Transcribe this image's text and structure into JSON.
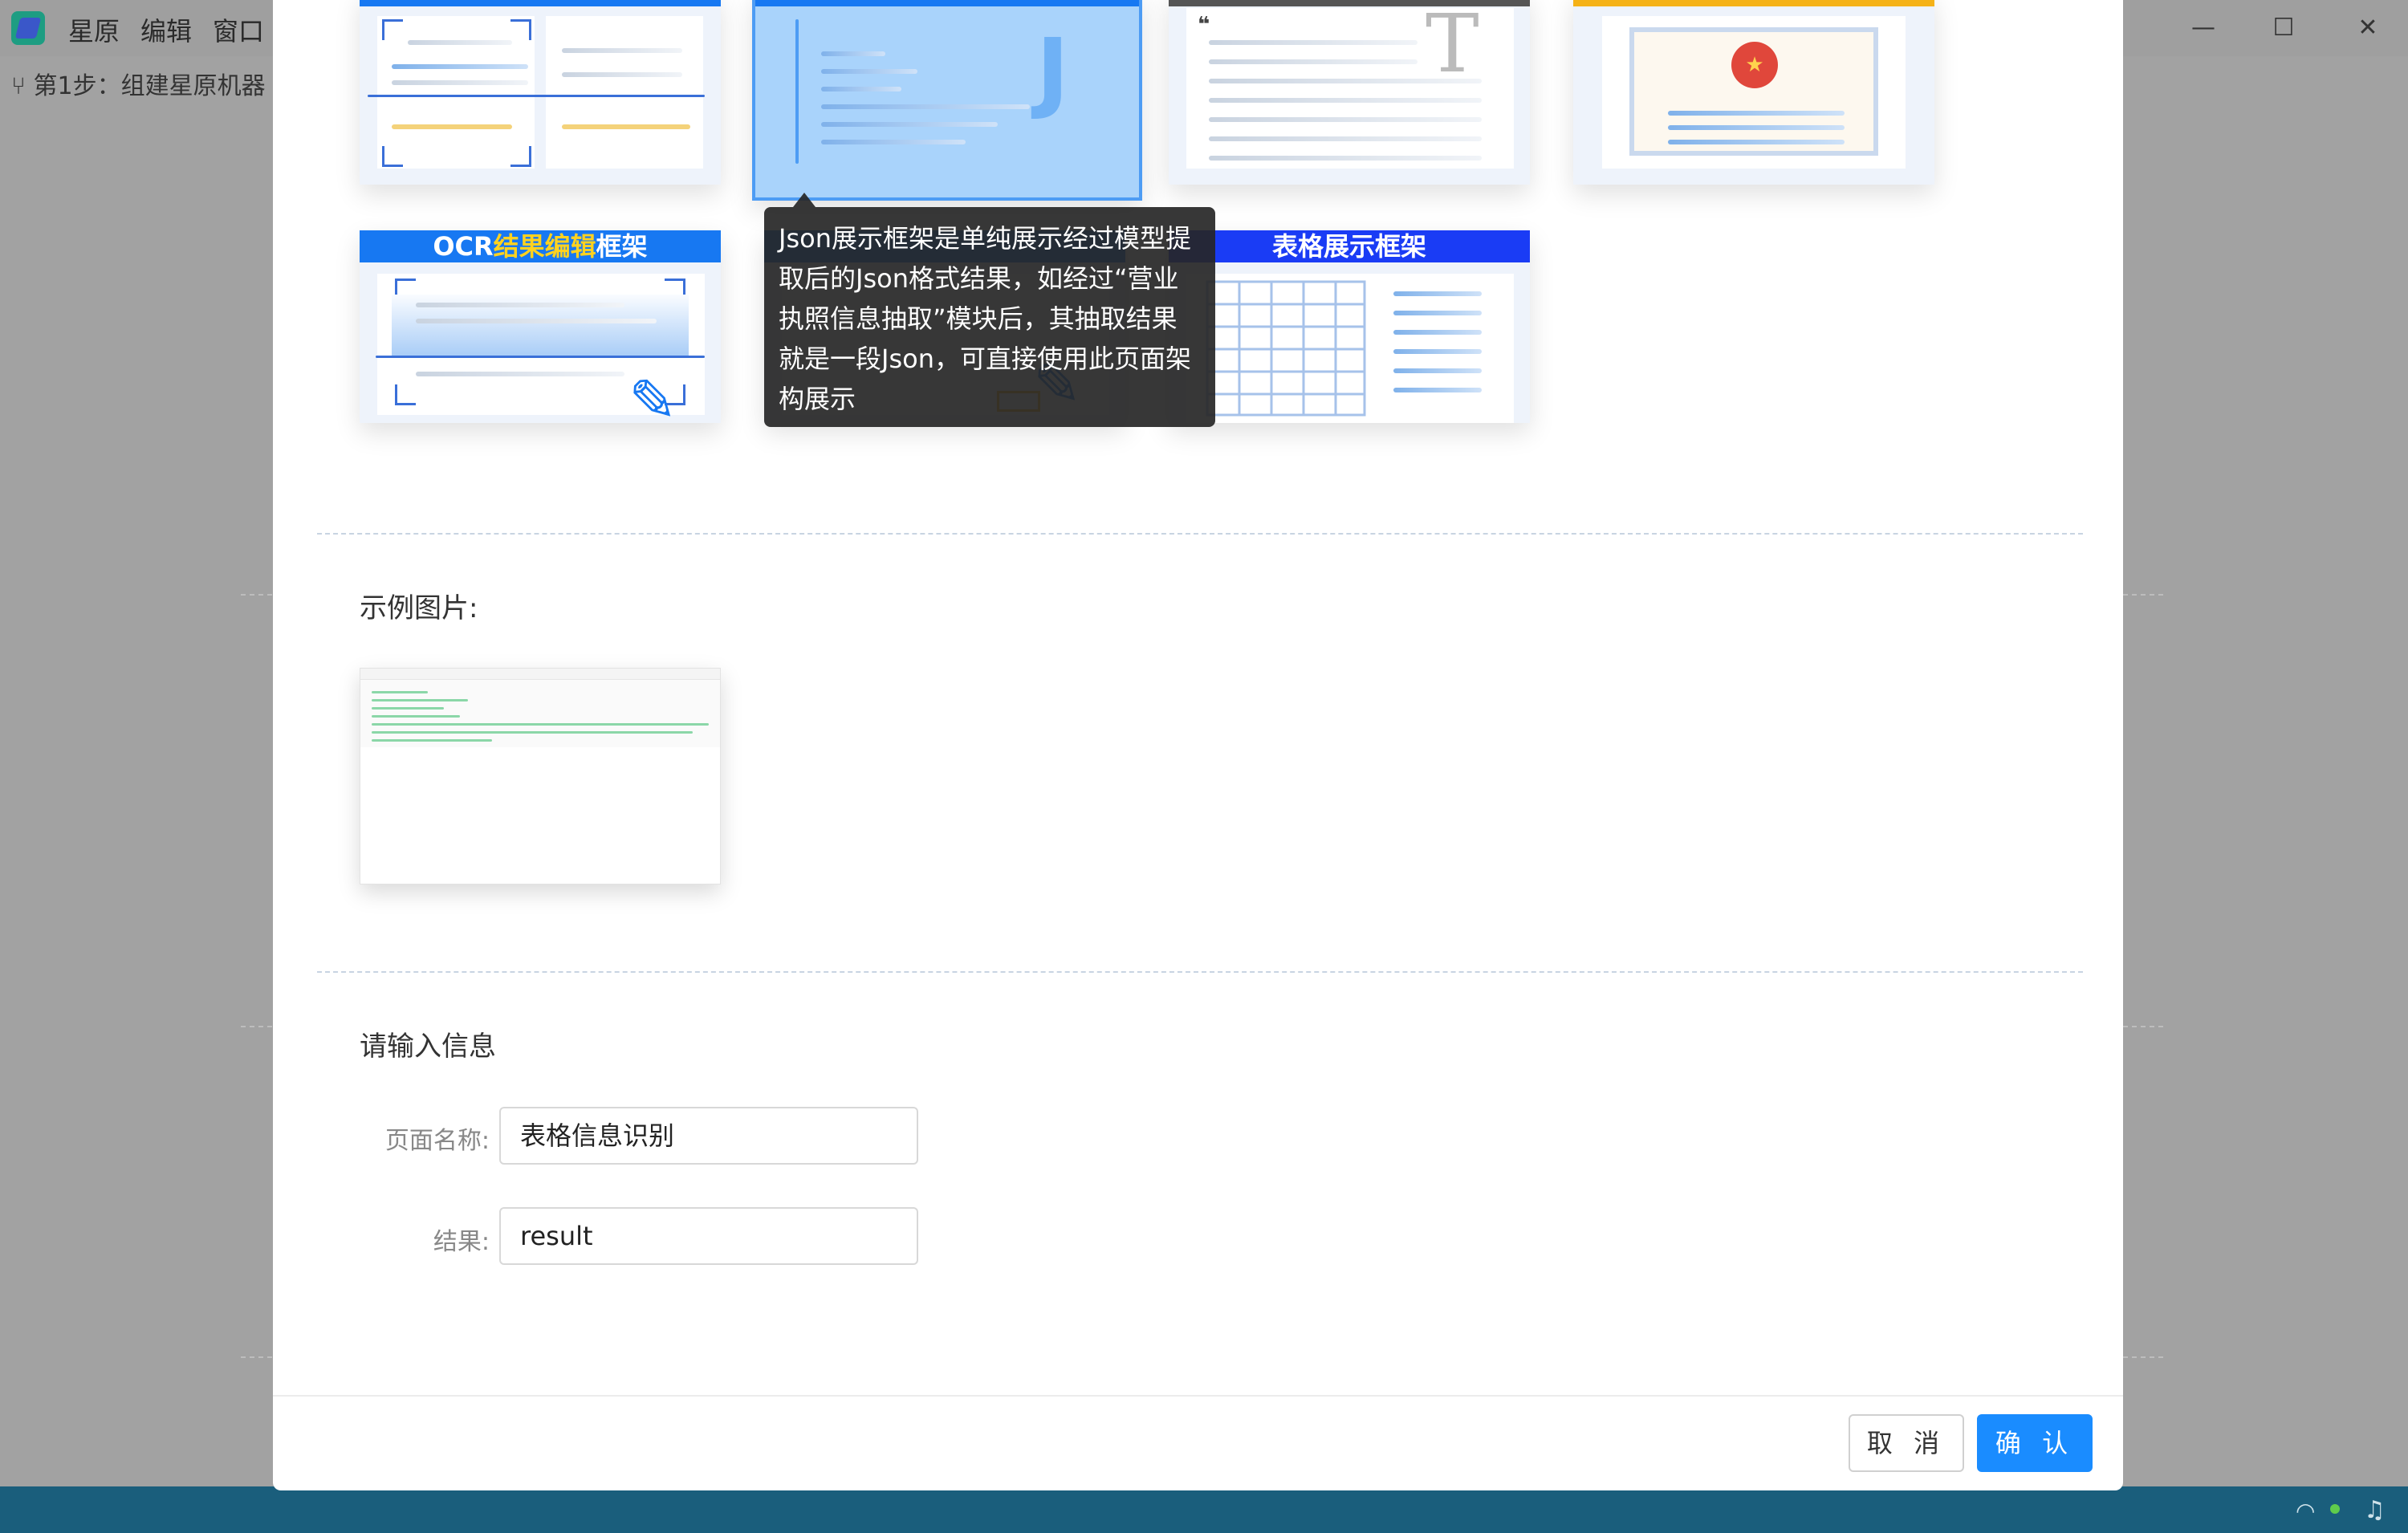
{
  "app": {
    "menu": [
      "星原",
      "编辑",
      "窗口"
    ],
    "step_label": "第1步：组建星原机器",
    "window_controls": {
      "minimize": "—",
      "maximize": "☐",
      "close": "✕"
    }
  },
  "modal": {
    "frame_cards": [
      {
        "title": "OCR结果编辑框架",
        "title_prefix": "OCR",
        "title_highlight": "结果编辑",
        "title_suffix": "框架",
        "bar_color": "#1778f2"
      },
      {
        "title": "表格展示框架",
        "bar_color": "#1a3cf5"
      }
    ],
    "tooltip": "Json展示框架是单纯展示经过模型提取后的Json格式结果，如经过“营业执照信息抽取”模块后，其抽取结果就是一段Json，可直接使用此页面架构展示",
    "example_label": "示例图片:",
    "input_section_title": "请输入信息",
    "fields": [
      {
        "label": "页面名称:",
        "value": "表格信息识别"
      },
      {
        "label": "结果:",
        "value": "result"
      }
    ],
    "buttons": {
      "cancel": "取 消",
      "confirm": "确 认"
    }
  },
  "colors": {
    "accent": "#1a8cff",
    "taskbar": "#1a5e7c",
    "ocr_bar": "#1778f2",
    "table_bar": "#1a3cf5",
    "highlight_text": "#ffd21f"
  }
}
